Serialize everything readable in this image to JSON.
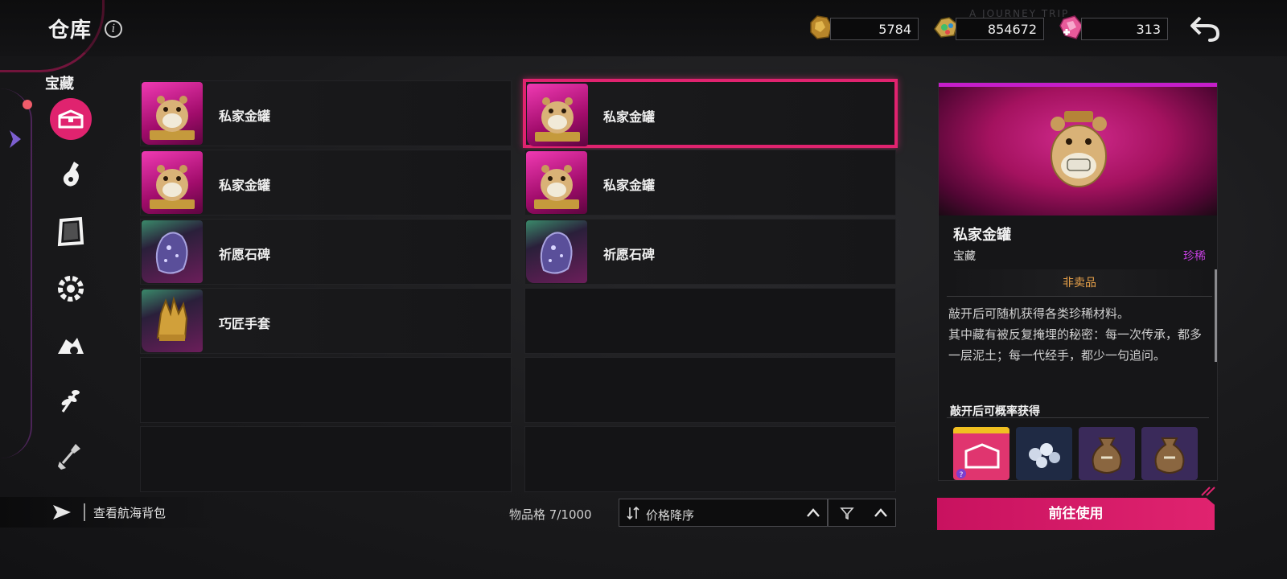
{
  "header": {
    "title": "仓库",
    "info_icon": "info-icon",
    "watermark": "A JOURNEY TRIP",
    "currencies": [
      {
        "icon": "gold-ore-icon",
        "value": "5784"
      },
      {
        "icon": "gem-cluster-icon",
        "value": "854672"
      },
      {
        "icon": "pink-crystal-plus-icon",
        "value": "313"
      }
    ],
    "back_icon": "back-arrow-icon"
  },
  "sidebar": {
    "category_label": "宝藏",
    "items": [
      {
        "icon": "treasure-chest-icon",
        "active": true
      },
      {
        "icon": "potion-bottle-icon",
        "active": false
      },
      {
        "icon": "scroll-frame-icon",
        "active": false
      },
      {
        "icon": "gear-cog-icon",
        "active": false
      },
      {
        "icon": "mechanism-icon",
        "active": false
      },
      {
        "icon": "herb-sprig-icon",
        "active": false
      },
      {
        "icon": "shovel-icon",
        "active": false
      }
    ]
  },
  "inventory": {
    "slots": [
      {
        "name": "私家金罐",
        "icon": "hamster-pot-icon",
        "rarity": "rare",
        "selected": false
      },
      {
        "name": "私家金罐",
        "icon": "hamster-pot-icon",
        "rarity": "rare",
        "selected": true
      },
      {
        "name": "私家金罐",
        "icon": "hamster-pot-icon",
        "rarity": "rare",
        "selected": false
      },
      {
        "name": "私家金罐",
        "icon": "hamster-pot-icon",
        "rarity": "rare",
        "selected": false
      },
      {
        "name": "祈愿石碑",
        "icon": "wish-stone-icon",
        "rarity": "uncommon",
        "selected": false
      },
      {
        "name": "祈愿石碑",
        "icon": "wish-stone-icon",
        "rarity": "uncommon",
        "selected": false
      },
      {
        "name": "巧匠手套",
        "icon": "golden-gauntlet-icon",
        "rarity": "uncommon",
        "selected": false
      },
      {
        "name": "",
        "empty": true
      },
      {
        "name": "",
        "empty": true
      },
      {
        "name": "",
        "empty": true
      },
      {
        "name": "",
        "empty": true
      },
      {
        "name": "",
        "empty": true
      }
    ]
  },
  "footer": {
    "sea_bag_label": "查看航海背包",
    "slot_count_label": "物品格",
    "slot_count": "7/1000",
    "sort_label": "价格降序",
    "filter_icon": "filter-icon"
  },
  "detail": {
    "name": "私家金罐",
    "category": "宝藏",
    "rarity": "珍稀",
    "sell_status": "非卖品",
    "description": "敲开后可随机获得各类珍稀材料。\n其中藏有被反复掩埋的秘密：每一次传承，都多一层泥土；每一代经手，都少一句追问。",
    "drops_title": "敲开后可概率获得",
    "drops": [
      {
        "icon": "mystery-chest-icon"
      },
      {
        "icon": "silver-pearls-icon"
      },
      {
        "icon": "money-bag-icon"
      },
      {
        "icon": "money-bag-icon"
      }
    ],
    "action_label": "前往使用"
  },
  "colors": {
    "accent": "#e0236f",
    "rare_purple": "#c53fe0",
    "no_sell_orange": "#e9a24a"
  }
}
